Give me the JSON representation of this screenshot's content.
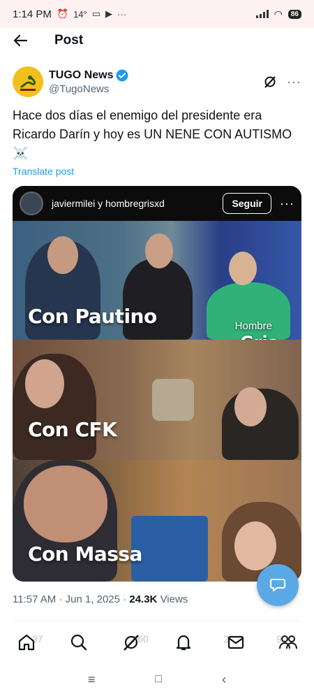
{
  "status": {
    "time": "1:14 PM",
    "temp": "14°",
    "battery": "86"
  },
  "header": {
    "title": "Post"
  },
  "author": {
    "name": "TUGO News",
    "handle": "@TugoNews"
  },
  "tweet": {
    "text": "Hace dos días el enemigo del presidente era Ricardo Darín y hoy es UN NENE CON AUTISMO",
    "emoji": "☠️",
    "translate": "Translate post"
  },
  "media": {
    "ig_names": "javiermilei y hombregrisxd",
    "follow": "Seguir",
    "panel_1": "Con Pautino",
    "panel_2": "Con CFK",
    "panel_3": "Con Massa",
    "hombre": "Hombre",
    "gris": "Gris"
  },
  "meta": {
    "time": "11:57 AM",
    "date": "Jun 1, 2025",
    "views_count": "24.3K",
    "views_label": "Views",
    "separator": "·"
  },
  "engagement": {
    "replies": "37",
    "reposts": "360",
    "likes": "2",
    "bookmarks": "9"
  },
  "icons": [
    "back-arrow-icon",
    "grok-icon",
    "more-icon",
    "verified-badge-icon",
    "message-icon",
    "home-icon",
    "search-icon",
    "grok-icon",
    "bell-icon",
    "mail-icon",
    "communities-icon"
  ]
}
